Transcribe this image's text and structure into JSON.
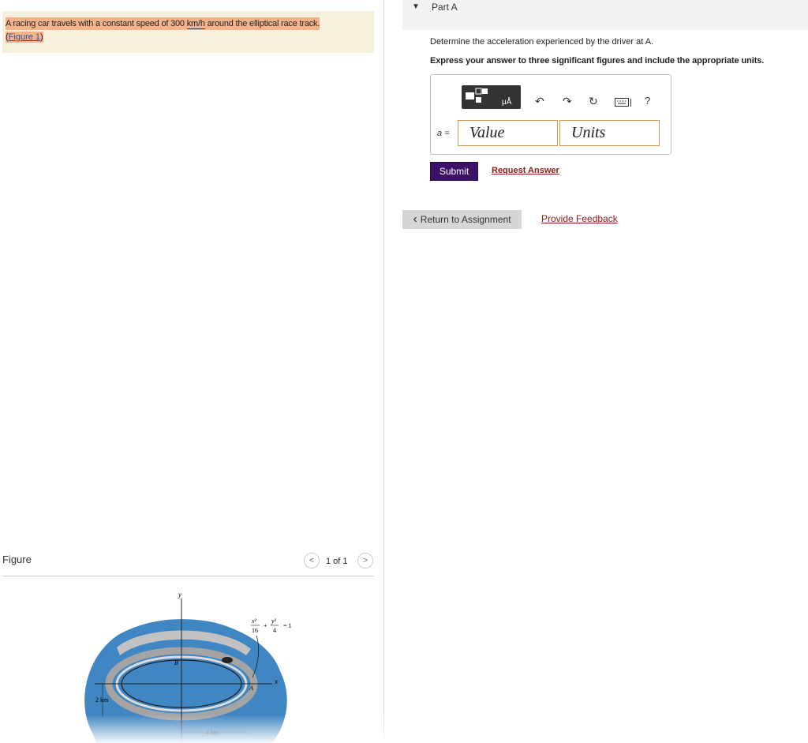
{
  "problem": {
    "text_before": "A racing car travels with a constant speed of 300 ",
    "unit": "km/h",
    "text_after": " around the elliptical race track.",
    "figure_link_open": "(",
    "figure_link": "Figure 1",
    "figure_link_close": ")"
  },
  "figure_panel": {
    "title": "Figure",
    "pager": "1 of 1",
    "prev_icon": "chevron-left-icon",
    "next_icon": "chevron-right-icon",
    "labels": {
      "y_axis": "y",
      "x_axis": "x",
      "point_b": "B",
      "point_a": "A",
      "equation_plus": "+",
      "equation_rhs": "= 1",
      "eq_x_num": "x²",
      "eq_x_den": "16",
      "eq_y_num": "y²",
      "eq_y_den": "4",
      "dim_vertical": "2 km",
      "dim_horizontal": "4 km"
    },
    "colors": {
      "background": "#3f86c2",
      "track": "#a4a4a4"
    }
  },
  "part": {
    "caret": "▼",
    "title": "Part A"
  },
  "question": {
    "text": "Determine the acceleration experienced by the driver at A.",
    "instruction": "Express your answer to three significant figures and include the appropriate units."
  },
  "toolbar": {
    "templates_icon": "templates-icon",
    "units_icon": "units-icon",
    "units_label": "μÅ",
    "undo_icon": "↶",
    "redo_icon": "↷",
    "reset_icon": "↻",
    "keyboard_icon": "keyboard-icon",
    "help_label": "?"
  },
  "answer": {
    "label": "a =",
    "value_placeholder": "Value",
    "units_placeholder": "Units"
  },
  "actions": {
    "submit": "Submit",
    "request_answer": "Request Answer",
    "return": "Return to Assignment",
    "return_icon": "‹",
    "feedback": "Provide Feedback"
  }
}
